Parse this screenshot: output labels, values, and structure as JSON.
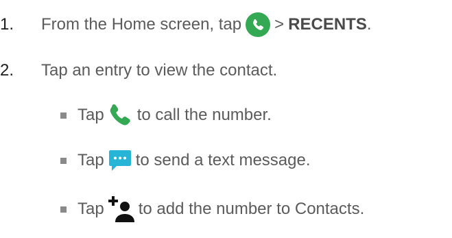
{
  "steps": [
    {
      "number": "1.",
      "text_before": "From the Home screen, tap",
      "icon": "phone-app-icon",
      "text_after": ">",
      "bold": "RECENTS",
      "end": "."
    },
    {
      "number": "2.",
      "text": "Tap an entry to view the contact."
    }
  ],
  "bullets": [
    {
      "prefix": "Tap",
      "icon": "phone-call-icon",
      "text": "to call the number."
    },
    {
      "prefix": "Tap",
      "icon": "message-icon",
      "text": "to send a text message."
    },
    {
      "prefix": "Tap",
      "icon": "add-contact-icon",
      "text": "to add the number to Contacts."
    }
  ],
  "colors": {
    "phone_green": "#34a853",
    "message_blue": "#26b5d6",
    "text_gray": "#5b5b5b",
    "bullet_gray": "#8a8a8a"
  }
}
